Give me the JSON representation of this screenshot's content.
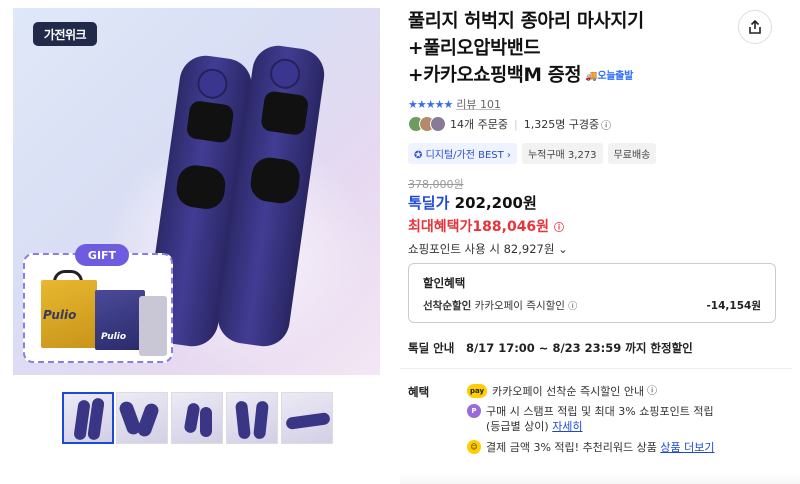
{
  "product": {
    "badge": "가전위크",
    "gift_label": "GIFT",
    "brand_logo": "Pulio",
    "title_lines": [
      "풀리지 허벅지 종아리 마사지기",
      "+풀리오압박밴드",
      "+카카오쇼핑백M 증정"
    ],
    "today_delivery": "오늘출발"
  },
  "rating": {
    "stars": "★★★★★",
    "review_label": "리뷰 101"
  },
  "orders": {
    "order_count": "14개 주문중",
    "subscribers": "1,325명 구경중"
  },
  "tags": [
    "디지털/가전 BEST",
    "누적구매 3,273",
    "무료배송"
  ],
  "price": {
    "original": "378,000원",
    "deal_label": "톡딜가",
    "deal_price": "202,200원",
    "max_label": "최대혜택가",
    "max_price": "188,046원",
    "points_label": "쇼핑포인트 사용 시",
    "points_value": "82,927원"
  },
  "coupon": {
    "heading": "할인혜택",
    "item_bold": "선착순할인",
    "item_text": "카카오페이 즉시할인",
    "amount": "-14,154원"
  },
  "deal_notice": {
    "label": "톡딜 안내",
    "text": "8/17 17:00 ~ 8/23 23:59 까지 한정할인"
  },
  "benefits": {
    "heading": "혜택",
    "items": [
      {
        "icon": "kakaopay-icon",
        "text": "카카오페이 선착순 즉시할인 안내"
      },
      {
        "icon": "point-icon",
        "text": "구매 시 스탬프 적립 및 최대 3% 쇼핑포인트 적립",
        "text2": "(등급별 상이)",
        "link": "자세히"
      },
      {
        "icon": "smile-icon",
        "text": "결제 금액 3% 적립! 추천리워드 상품",
        "link": "상품 더보기"
      }
    ]
  },
  "colors": {
    "accent": "#1c4ad6",
    "red": "#e8333b",
    "device": "#3a3585"
  }
}
